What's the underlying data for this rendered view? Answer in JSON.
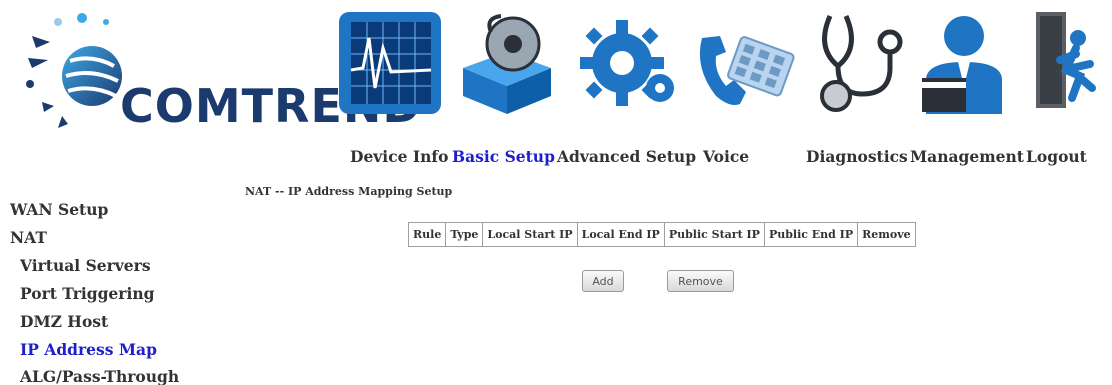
{
  "brand": {
    "logo_text": "COMTREND"
  },
  "nav": [
    {
      "id": "device-info",
      "label": "Device Info",
      "icon": "device-info-icon"
    },
    {
      "id": "basic-setup",
      "label": "Basic Setup",
      "icon": "basic-setup-icon"
    },
    {
      "id": "advanced-setup",
      "label": "Advanced Setup",
      "icon": "advanced-setup-icon"
    },
    {
      "id": "voice",
      "label": "Voice",
      "icon": "voice-icon"
    },
    {
      "id": "diagnostics",
      "label": "Diagnostics",
      "icon": "diagnostics-icon"
    },
    {
      "id": "management",
      "label": "Management",
      "icon": "management-icon"
    },
    {
      "id": "logout",
      "label": "Logout",
      "icon": "logout-icon"
    }
  ],
  "nav_active": "basic-setup",
  "sidebar": {
    "items": [
      {
        "label": "WAN Setup"
      },
      {
        "label": "NAT"
      },
      {
        "label": "Virtual Servers"
      },
      {
        "label": "Port Triggering"
      },
      {
        "label": "DMZ Host"
      },
      {
        "label": "IP Address Map"
      },
      {
        "label": "ALG/Pass-Through"
      }
    ],
    "active": "IP Address Map"
  },
  "main": {
    "title": "NAT -- IP Address Mapping Setup",
    "table": {
      "columns": [
        "Rule",
        "Type",
        "Local Start IP",
        "Local End IP",
        "Public Start IP",
        "Public End IP",
        "Remove"
      ],
      "rows": []
    },
    "buttons": {
      "add": "Add",
      "remove": "Remove"
    }
  },
  "colors": {
    "active_text": "#1e1ecb",
    "text": "#333333",
    "logo_blue": "#1b3a6e",
    "icon_blue": "#1f74c4"
  }
}
